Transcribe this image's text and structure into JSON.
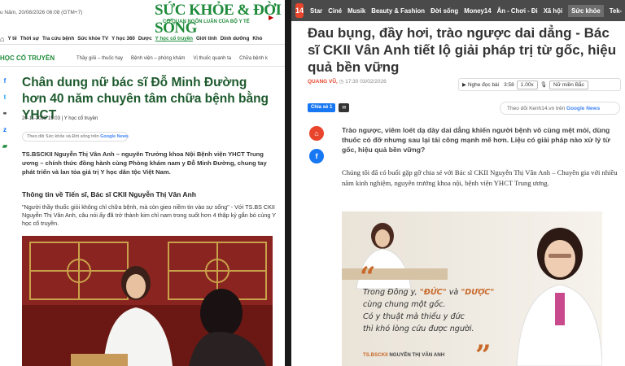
{
  "left": {
    "date": "u Năm, 20/08/2026 06:08 (GTM+7)",
    "logo": "SỨC KHỎE & ĐỜI SỐNG",
    "logo_sub": "CƠ QUAN NGÔN LUẬN CỦA BỘ Y TẾ",
    "nav": [
      "Y tế",
      "Thời sự",
      "Tra cứu bệnh",
      "Sức khỏe TV",
      "Y học 360",
      "Dược",
      "Y học cổ truyền",
      "Giới tính",
      "Dinh dưỡng",
      "Khỏ"
    ],
    "section": {
      "title": "HỌC CỔ TRUYỀN",
      "subs": [
        "Thầy giỏi – thuốc hay",
        "Bệnh viện – phòng khám",
        "Vị thuốc quanh ta",
        "Chữa bệnh k"
      ]
    },
    "article": {
      "title": "Chân dung nữ bác sĩ Đỗ Minh Đường hơn 40 năm chuyên tâm chữa bệnh bằng YHCT",
      "meta_date": "20-11-2025 15:03",
      "meta_cat": "Y học cổ truyền",
      "follow_text": "Theo dõi Sức khỏe và Đời sống trên",
      "follow_brand": "Google News",
      "lead": "TS.BSCKII Nguyễn Thị Vân Anh – nguyên Trưởng khoa Nội Bệnh viện YHCT Trung ương – chính thức đồng hành cùng Phòng khám nam y Đỗ Minh Đường, chung tay phát triển và lan tỏa giá trị Y học dân tộc Việt Nam.",
      "heading": "Thông tin về Tiến sĩ, Bác sĩ CKII Nguyễn Thị Vân Anh",
      "para": "\"Người thầy thuốc giỏi không chỉ chữa bệnh, mà còn gieo niềm tin vào sự sống\" - Với TS.BS CKII Nguyễn Thị Vân Anh, câu nói ấy đã trở thành kim chỉ nam trong suốt hơn 4 thập kỷ gắn bó cùng Y học cổ truyền."
    }
  },
  "right": {
    "logo": "14",
    "nav": [
      "Star",
      "Ciné",
      "Musik",
      "Beauty & Fashion",
      "Đời sống",
      "Money14",
      "Ăn - Chơi - Đi",
      "Xã hội",
      "Sức khỏe",
      "Tek-"
    ],
    "active_nav": "Sức khỏe",
    "article": {
      "title": "Đau bụng, đầy hơi, trào ngược dai dẳng - Bác sĩ CKII Vân Anh tiết lộ giải pháp trị từ gốc, hiệu quả bền vững",
      "author": "QUANG VŨ,",
      "time": "17:30 03/02/2026",
      "audio_label": "Nghe đọc bài",
      "audio_duration": "3:58",
      "audio_speed": "1.00x",
      "audio_voice": "Nữ miền Bắc",
      "share_fb": "Chia sẻ 1",
      "follow_text": "Theo dõi Kenh14.vn trên",
      "follow_brand": "Google News",
      "sapo": "Trào ngược, viêm loét dạ dày dai dẳng khiến người bệnh vô cùng mệt mỏi, dùng thuốc có đỡ nhưng sau lại tái công mạnh mẽ hơn. Liệu có giải pháp nào xử lý từ gốc, hiệu quả bền vững?",
      "body": "Chúng tôi đã có buổi gặp gỡ chia sẻ với Bác sĩ CKII Nguyễn Thị Vân Anh – Chuyên gia với nhiều năm kinh nghiệm, nguyên trưởng khoa nội, bệnh viện YHCT Trung ương.",
      "quote_line1_a": "Trong Đông y, ",
      "quote_duc": "\"ĐỨC\"",
      "quote_line1_b": " và ",
      "quote_duoc": "\"DƯỢC\"",
      "quote_line2": "cùng chung một gốc.",
      "quote_line3": "Có y thuật mà thiếu y đức",
      "quote_line4": "thì khó lòng cứu được người.",
      "sign_prefix": "TS.BSCKII ",
      "sign_name": "NGUYỄN THỊ VÂN ANH"
    }
  },
  "colors": {
    "left_green": "#1e8b3a",
    "left_title": "#1e5a2e",
    "k14_red": "#e8452c",
    "k14_nav": "#4a4a4a",
    "quote_orange": "#c8692a"
  }
}
